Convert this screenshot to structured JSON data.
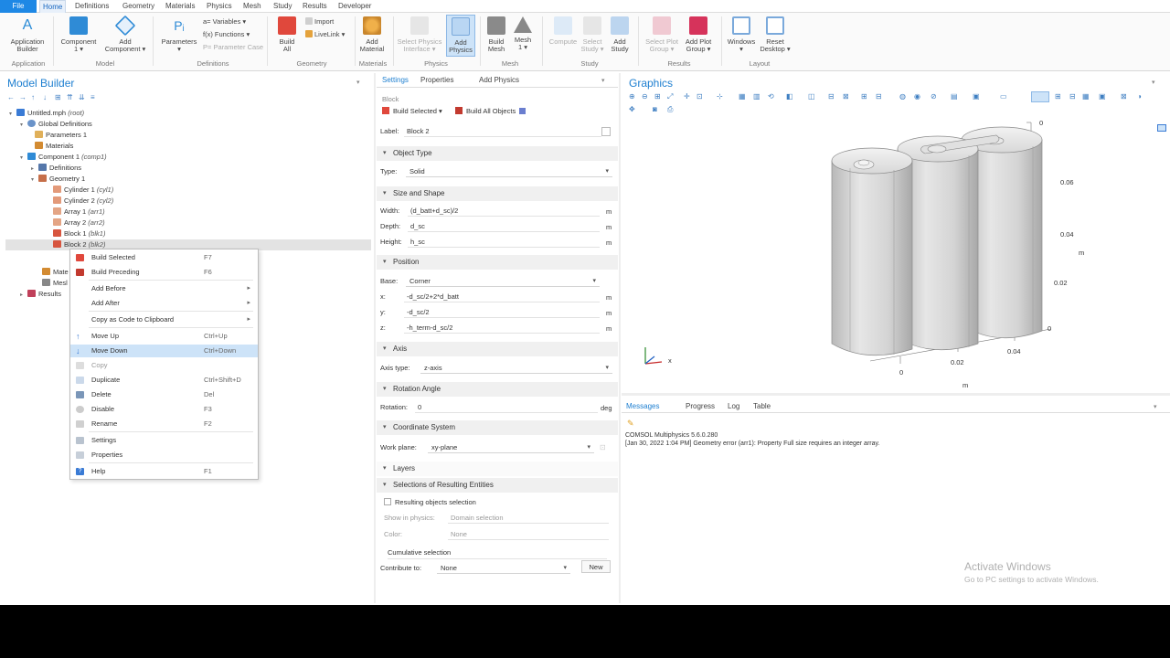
{
  "menubar": {
    "tabs": [
      "File",
      "Home",
      "Definitions",
      "Geometry",
      "Materials",
      "Physics",
      "Mesh",
      "Study",
      "Results",
      "Developer"
    ],
    "active": "Home"
  },
  "ribbon": {
    "app_builder": "Application\nBuilder",
    "component": "Component\n1 ▾",
    "add_component": "Add\nComponent ▾",
    "parameters": "Parameters\n▾",
    "variables": "a= Variables ▾",
    "functions": "f(x) Functions ▾",
    "parameter_case": "P= Parameter Case",
    "build_all": "Build\nAll",
    "import": "Import",
    "livelink": "LiveLink ▾",
    "add_material": "Add\nMaterial",
    "select_physics_interface": "Select Physics\nInterface ▾",
    "add_physics": "Add\nPhysics",
    "build_mesh": "Build\nMesh",
    "mesh1": "Mesh\n1 ▾",
    "compute": "Compute",
    "select_study": "Select\nStudy ▾",
    "add_study": "Add\nStudy",
    "select_plot_group": "Select Plot\nGroup ▾",
    "add_plot_group": "Add Plot\nGroup ▾",
    "windows": "Windows\n▾",
    "reset_desktop": "Reset\nDesktop ▾",
    "groups": [
      "Application",
      "Model",
      "Definitions",
      "Geometry",
      "Materials",
      "Physics",
      "Mesh",
      "Study",
      "Results",
      "Layout"
    ]
  },
  "model_builder": {
    "title": "Model Builder",
    "tree": [
      {
        "label": "Untitled.mph",
        "suffix": "(root)"
      },
      {
        "label": "Global Definitions",
        "suffix": ""
      },
      {
        "label": "Parameters 1",
        "suffix": ""
      },
      {
        "label": "Materials",
        "suffix": ""
      },
      {
        "label": "Component 1",
        "suffix": "(comp1)"
      },
      {
        "label": "Definitions",
        "suffix": ""
      },
      {
        "label": "Geometry 1",
        "suffix": ""
      },
      {
        "label": "Cylinder 1",
        "suffix": "(cyl1)"
      },
      {
        "label": "Cylinder 2",
        "suffix": "(cyl2)"
      },
      {
        "label": "Array 1",
        "suffix": "(arr1)"
      },
      {
        "label": "Array 2",
        "suffix": "(arr2)"
      },
      {
        "label": "Block 1",
        "suffix": "(blk1)"
      },
      {
        "label": "Block 2",
        "suffix": "(blk2)"
      },
      {
        "label": "Mate",
        "suffix": ""
      },
      {
        "label": "Mesl",
        "suffix": ""
      },
      {
        "label": "Results",
        "suffix": ""
      }
    ]
  },
  "context_menu": {
    "items": [
      {
        "label": "Build Selected",
        "shortcut": "F7"
      },
      {
        "label": "Build Preceding",
        "shortcut": "F6"
      },
      {
        "label": "Add Before",
        "shortcut": "▸"
      },
      {
        "label": "Add After",
        "shortcut": "▸"
      },
      {
        "label": "Copy as Code to Clipboard",
        "shortcut": "▸"
      },
      {
        "label": "Move Up",
        "shortcut": "Ctrl+Up"
      },
      {
        "label": "Move Down",
        "shortcut": "Ctrl+Down"
      },
      {
        "label": "Copy",
        "shortcut": ""
      },
      {
        "label": "Duplicate",
        "shortcut": "Ctrl+Shift+D"
      },
      {
        "label": "Delete",
        "shortcut": "Del"
      },
      {
        "label": "Disable",
        "shortcut": "F3"
      },
      {
        "label": "Rename",
        "shortcut": "F2"
      },
      {
        "label": "Settings",
        "shortcut": ""
      },
      {
        "label": "Properties",
        "shortcut": ""
      },
      {
        "label": "Help",
        "shortcut": "F1"
      }
    ]
  },
  "settings": {
    "tabs": [
      "Settings",
      "Properties",
      "Add Physics"
    ],
    "heading": "Block",
    "build_selected": "Build Selected ▾",
    "build_all_objects": "Build All Objects",
    "label_caption": "Label:",
    "label_value": "Block 2",
    "object_type": {
      "title": "Object Type",
      "type_caption": "Type:",
      "type_value": "Solid"
    },
    "size_shape": {
      "title": "Size and Shape",
      "width_caption": "Width:",
      "width_value": "(d_batt+d_sc)/2",
      "depth_caption": "Depth:",
      "depth_value": "d_sc",
      "height_caption": "Height:",
      "height_value": "h_sc",
      "unit": "m"
    },
    "position": {
      "title": "Position",
      "base_caption": "Base:",
      "base_value": "Corner",
      "x_caption": "x:",
      "x_value": "-d_sc/2+2*d_batt",
      "y_caption": "y:",
      "y_value": "-d_sc/2",
      "z_caption": "z:",
      "z_value": "-h_term-d_sc/2",
      "unit": "m"
    },
    "axis": {
      "title": "Axis",
      "axis_type_caption": "Axis type:",
      "axis_type_value": "z-axis"
    },
    "rotation": {
      "title": "Rotation Angle",
      "rotation_caption": "Rotation:",
      "rotation_value": "0",
      "unit": "deg"
    },
    "coordinate_system": {
      "title": "Coordinate System",
      "work_plane_caption": "Work plane:",
      "work_plane_value": "xy-plane"
    },
    "layers": {
      "title": "Layers"
    },
    "selections": {
      "title": "Selections of Resulting Entities",
      "checkbox_label": "Resulting objects selection",
      "show_in_physics_caption": "Show in physics:",
      "show_in_physics_value": "Domain selection",
      "color_caption": "Color:",
      "color_value": "None",
      "cumulative_caption": "Cumulative selection",
      "contribute_caption": "Contribute to:",
      "contribute_value": "None",
      "new_button": "New"
    }
  },
  "graphics": {
    "title": "Graphics",
    "axis_labels": {
      "z_top": "0",
      "z_006": "0.06",
      "z_004": "0.04",
      "z_m": "m",
      "z_002": "0.02",
      "z_0": "0",
      "x_004": "0.04",
      "x_002": "0.02",
      "x_0": "0",
      "x_m": "m",
      "triad_x": "x"
    }
  },
  "messages": {
    "tabs": [
      "Messages",
      "Progress",
      "Log",
      "Table"
    ],
    "lines": [
      "COMSOL Multiphysics 5.6.0.280",
      "[Jan 30, 2022 1:04 PM] Geometry error (arr1): Property Full size requires an integer array."
    ]
  },
  "watermark": {
    "line1": "Activate Windows",
    "line2": "Go to PC settings to activate Windows."
  },
  "colors": {
    "accent": "#1e88e5",
    "title_blue": "#1e7fd0",
    "highlight": "#cde3f8"
  }
}
